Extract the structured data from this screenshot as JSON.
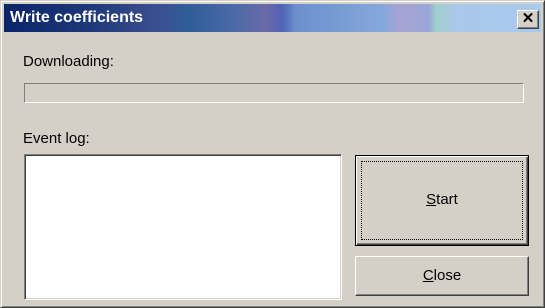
{
  "window": {
    "title": "Write coefficients",
    "close_glyph": "✕"
  },
  "download": {
    "label": "Downloading:",
    "progress": 0
  },
  "event_log": {
    "label": "Event log:",
    "entries": []
  },
  "buttons": {
    "start": {
      "mnemonic": "S",
      "rest": "tart"
    },
    "close": {
      "mnemonic": "C",
      "rest": "lose"
    }
  }
}
